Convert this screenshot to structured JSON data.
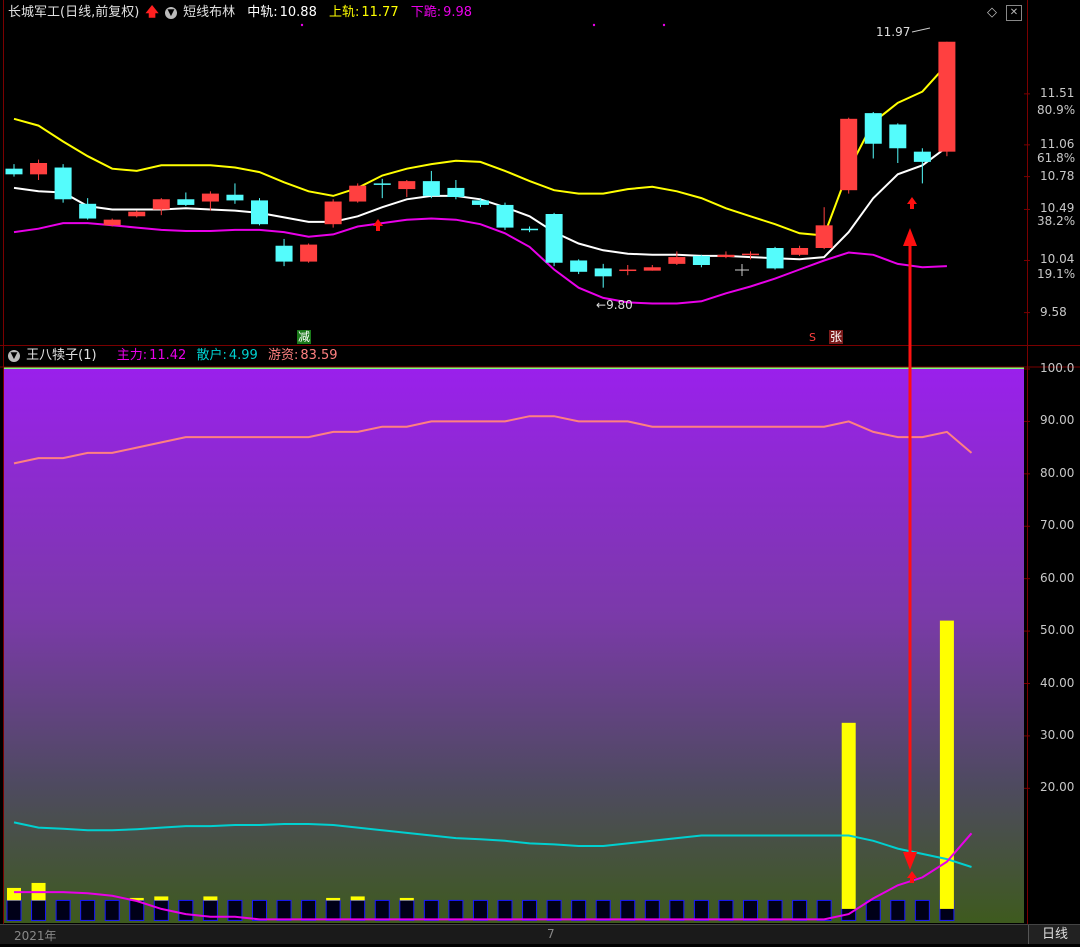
{
  "main_panel": {
    "title": "长城军工(日线,前复权)",
    "indicator": "短线布林",
    "mid_label": "中轨:",
    "mid_value": "10.88",
    "upper_label": "上轨:",
    "upper_value": "11.77",
    "lower_label": "下跪:",
    "lower_value": "9.98",
    "high_marker": "11.97",
    "low_marker": "9.80",
    "signal_jian": "减",
    "signal_s": "S",
    "signal_zhang": "张",
    "price_labels": [
      "11.51",
      "11.06",
      "10.78",
      "10.49",
      "10.04",
      "9.58"
    ],
    "pct_labels": [
      "80.9%",
      "61.8%",
      "38.2%",
      "19.1%"
    ]
  },
  "sub_panel": {
    "title": "王八犊子(1)",
    "main_label": "主力:",
    "main_value": "11.42",
    "retail_label": "散户:",
    "retail_value": "4.99",
    "hot_label": "游资:",
    "hot_value": "83.59",
    "axis_labels": [
      "100.0",
      "90.00",
      "80.00",
      "70.00",
      "60.00",
      "50.00",
      "40.00",
      "30.00",
      "20.00"
    ]
  },
  "bottom": {
    "year_label": "2021年",
    "month_label": "7",
    "period_button": "日线"
  },
  "colors": {
    "up": "#ff4040",
    "down": "#54fcfc",
    "mid": "#ffffff",
    "upper": "#ffff00",
    "lower": "#e800e8",
    "hot": "#ff8080",
    "retail": "#00d0d0"
  },
  "chart_data": {
    "type": "candlestick",
    "price_ylim": [
      9.4,
      12.1
    ],
    "candles": [
      {
        "o": 10.85,
        "c": 10.8,
        "h": 10.89,
        "l": 10.78
      },
      {
        "o": 10.8,
        "c": 10.9,
        "h": 10.93,
        "l": 10.75
      },
      {
        "o": 10.86,
        "c": 10.58,
        "h": 10.89,
        "l": 10.55
      },
      {
        "o": 10.54,
        "c": 10.41,
        "h": 10.59,
        "l": 10.4
      },
      {
        "o": 10.35,
        "c": 10.4,
        "h": 10.41,
        "l": 10.34
      },
      {
        "o": 10.43,
        "c": 10.47,
        "h": 10.48,
        "l": 10.42
      },
      {
        "o": 10.49,
        "c": 10.58,
        "h": 10.59,
        "l": 10.44
      },
      {
        "o": 10.58,
        "c": 10.53,
        "h": 10.64,
        "l": 10.52
      },
      {
        "o": 10.56,
        "c": 10.63,
        "h": 10.65,
        "l": 10.48
      },
      {
        "o": 10.62,
        "c": 10.57,
        "h": 10.72,
        "l": 10.54
      },
      {
        "o": 10.57,
        "c": 10.36,
        "h": 10.59,
        "l": 10.35
      },
      {
        "o": 10.17,
        "c": 10.03,
        "h": 10.23,
        "l": 9.99
      },
      {
        "o": 10.03,
        "c": 10.18,
        "h": 10.19,
        "l": 10.02
      },
      {
        "o": 10.36,
        "c": 10.56,
        "h": 10.58,
        "l": 10.33
      },
      {
        "o": 10.56,
        "c": 10.7,
        "h": 10.72,
        "l": 10.55
      },
      {
        "o": 10.72,
        "c": 10.71,
        "h": 10.76,
        "l": 10.59
      },
      {
        "o": 10.67,
        "c": 10.74,
        "h": 10.75,
        "l": 10.6
      },
      {
        "o": 10.74,
        "c": 10.61,
        "h": 10.83,
        "l": 10.59
      },
      {
        "o": 10.68,
        "c": 10.6,
        "h": 10.75,
        "l": 10.58
      },
      {
        "o": 10.57,
        "c": 10.53,
        "h": 10.59,
        "l": 10.51
      },
      {
        "o": 10.53,
        "c": 10.33,
        "h": 10.55,
        "l": 10.31
      },
      {
        "o": 10.32,
        "c": 10.31,
        "h": 10.34,
        "l": 10.29
      },
      {
        "o": 10.45,
        "c": 10.02,
        "h": 10.46,
        "l": 9.99
      },
      {
        "o": 10.04,
        "c": 9.94,
        "h": 10.05,
        "l": 9.92
      },
      {
        "o": 9.97,
        "c": 9.9,
        "h": 10.01,
        "l": 9.8
      },
      {
        "o": 9.96,
        "c": 9.96,
        "h": 10.0,
        "l": 9.91
      },
      {
        "o": 9.95,
        "c": 9.98,
        "h": 10.0,
        "l": 9.95
      },
      {
        "o": 10.01,
        "c": 10.07,
        "h": 10.12,
        "l": 10.0
      },
      {
        "o": 10.08,
        "c": 10.0,
        "h": 10.09,
        "l": 9.98
      },
      {
        "o": 10.07,
        "c": 10.09,
        "h": 10.12,
        "l": 10.06
      },
      {
        "o": 10.1,
        "c": 10.1,
        "h": 10.12,
        "l": 10.05
      },
      {
        "o": 10.15,
        "c": 9.97,
        "h": 10.16,
        "l": 9.96
      },
      {
        "o": 10.09,
        "c": 10.15,
        "h": 10.17,
        "l": 10.08
      },
      {
        "o": 10.15,
        "c": 10.35,
        "h": 10.51,
        "l": 10.14
      },
      {
        "o": 10.66,
        "c": 11.29,
        "h": 11.3,
        "l": 10.63
      },
      {
        "o": 11.34,
        "c": 11.07,
        "h": 11.35,
        "l": 10.94
      },
      {
        "o": 11.24,
        "c": 11.03,
        "h": 11.25,
        "l": 10.9
      },
      {
        "o": 11.0,
        "c": 10.91,
        "h": 11.03,
        "l": 10.72
      },
      {
        "o": 11.0,
        "c": 11.97,
        "h": 11.97,
        "l": 10.96
      }
    ],
    "mid_line": [
      10.68,
      10.65,
      10.64,
      10.52,
      10.49,
      10.49,
      10.49,
      10.5,
      10.49,
      10.48,
      10.46,
      10.42,
      10.38,
      10.38,
      10.43,
      10.51,
      10.58,
      10.61,
      10.61,
      10.58,
      10.51,
      10.43,
      10.29,
      10.19,
      10.13,
      10.1,
      10.09,
      10.09,
      10.08,
      10.08,
      10.07,
      10.06,
      10.05,
      10.07,
      10.29,
      10.59,
      10.8,
      10.88,
      11.04
    ],
    "upper_line": [
      11.29,
      11.23,
      11.09,
      10.96,
      10.85,
      10.83,
      10.88,
      10.88,
      10.88,
      10.86,
      10.82,
      10.73,
      10.65,
      10.61,
      10.68,
      10.79,
      10.85,
      10.89,
      10.92,
      10.91,
      10.83,
      10.74,
      10.66,
      10.63,
      10.63,
      10.67,
      10.69,
      10.65,
      10.59,
      10.5,
      10.43,
      10.36,
      10.28,
      10.26,
      10.84,
      11.26,
      11.43,
      11.53,
      11.77
    ],
    "lower_line": [
      10.29,
      10.32,
      10.37,
      10.37,
      10.35,
      10.33,
      10.31,
      10.3,
      10.3,
      10.31,
      10.31,
      10.29,
      10.25,
      10.27,
      10.34,
      10.37,
      10.4,
      10.41,
      10.4,
      10.36,
      10.28,
      10.16,
      9.96,
      9.8,
      9.71,
      9.67,
      9.66,
      9.66,
      9.68,
      9.75,
      9.81,
      9.88,
      9.96,
      10.04,
      10.11,
      10.09,
      10.01,
      9.98,
      9.99
    ],
    "sub_ylim": [
      -5.5,
      100
    ],
    "hot_line": [
      82,
      83,
      83,
      84,
      84,
      85,
      86,
      87,
      87,
      87,
      87,
      87,
      87,
      88,
      88,
      89,
      89,
      90,
      90,
      90,
      90,
      91,
      91,
      90,
      90,
      90,
      89,
      89,
      89,
      89,
      89,
      89,
      89,
      89,
      90,
      88,
      87,
      87,
      88,
      84
    ],
    "retail_line": [
      13.5,
      12.5,
      12.3,
      12.0,
      12.0,
      12.2,
      12.5,
      12.8,
      12.8,
      13.0,
      13.0,
      13.2,
      13.2,
      13.0,
      12.5,
      12.0,
      11.5,
      11.0,
      10.5,
      10.3,
      10.0,
      9.5,
      9.3,
      9.0,
      9.0,
      9.5,
      10.0,
      10.5,
      11.0,
      11.0,
      11.0,
      11.0,
      11.0,
      11.0,
      11.0,
      10.0,
      8.5,
      7.5,
      6.5,
      4.99
    ],
    "main_line": [
      0.2,
      0.2,
      0.2,
      0.0,
      -0.5,
      -1.5,
      -3.0,
      -4.0,
      -4.5,
      -4.5,
      -5.0,
      -5.0,
      -5.0,
      -5.0,
      -5.0,
      -5.0,
      -5.0,
      -5.0,
      -5.0,
      -5.0,
      -5.0,
      -5.0,
      -5.0,
      -5.0,
      -5.0,
      -5.0,
      -5.0,
      -5.0,
      -5.0,
      -5.0,
      -5.0,
      -5.0,
      -5.0,
      -5.0,
      -4.0,
      -1.0,
      1.5,
      3.0,
      6.0,
      11.42
    ],
    "yellow_bars": [
      0,
      1,
      0,
      0,
      0,
      0,
      0,
      0,
      0,
      0,
      0,
      0,
      0,
      0,
      0,
      0,
      0,
      0,
      0,
      0,
      0,
      0,
      0,
      0,
      0,
      0,
      0,
      0,
      0,
      0,
      0,
      0,
      0,
      0,
      32.5,
      0,
      0,
      0,
      52
    ],
    "small_yellow": [
      {
        "i": 0,
        "h": 2.5
      },
      {
        "i": 1,
        "h": 3.5
      },
      {
        "i": 5,
        "h": 0.5
      },
      {
        "i": 6,
        "h": 0.8
      },
      {
        "i": 8,
        "h": 0.8
      },
      {
        "i": 13,
        "h": 0.5
      },
      {
        "i": 14,
        "h": 0.8
      },
      {
        "i": 16,
        "h": 0.5
      }
    ]
  }
}
